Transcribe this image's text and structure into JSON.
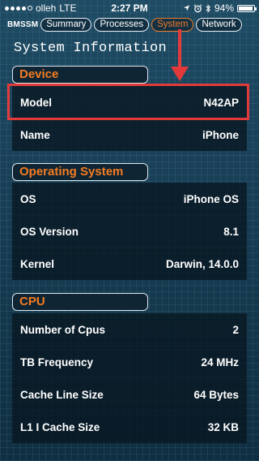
{
  "status_bar": {
    "carrier": "olleh",
    "network": "LTE",
    "time": "2:27 PM",
    "battery": "94%",
    "battery_level": 0.94,
    "icons": [
      "signal-dots-icon",
      "location-arrow-icon",
      "alarm-clock-icon",
      "bluetooth-icon",
      "battery-icon"
    ]
  },
  "app": {
    "name": "BMSSM",
    "tabs": [
      {
        "label": "Summary",
        "active": false
      },
      {
        "label": "Processes",
        "active": false
      },
      {
        "label": "System",
        "active": true
      },
      {
        "label": "Network",
        "active": false
      }
    ]
  },
  "page": {
    "title": "System Information"
  },
  "sections": {
    "device": {
      "label": "Device",
      "rows": [
        {
          "key": "Model",
          "value": "N42AP"
        },
        {
          "key": "Name",
          "value": "iPhone"
        }
      ]
    },
    "os": {
      "label": "Operating System",
      "rows": [
        {
          "key": "OS",
          "value": "iPhone OS"
        },
        {
          "key": "OS Version",
          "value": "8.1"
        },
        {
          "key": "Kernel",
          "value": "Darwin, 14.0.0"
        }
      ]
    },
    "cpu": {
      "label": "CPU",
      "rows": [
        {
          "key": "Number of Cpus",
          "value": "2"
        },
        {
          "key": "TB Frequency",
          "value": "24 MHz"
        },
        {
          "key": "Cache Line Size",
          "value": "64 Bytes"
        },
        {
          "key": "L1 I Cache Size",
          "value": "32 KB"
        }
      ]
    }
  },
  "colors": {
    "accent": "#f47c20",
    "annotation": "#e23a3a",
    "background": "#173c52"
  }
}
